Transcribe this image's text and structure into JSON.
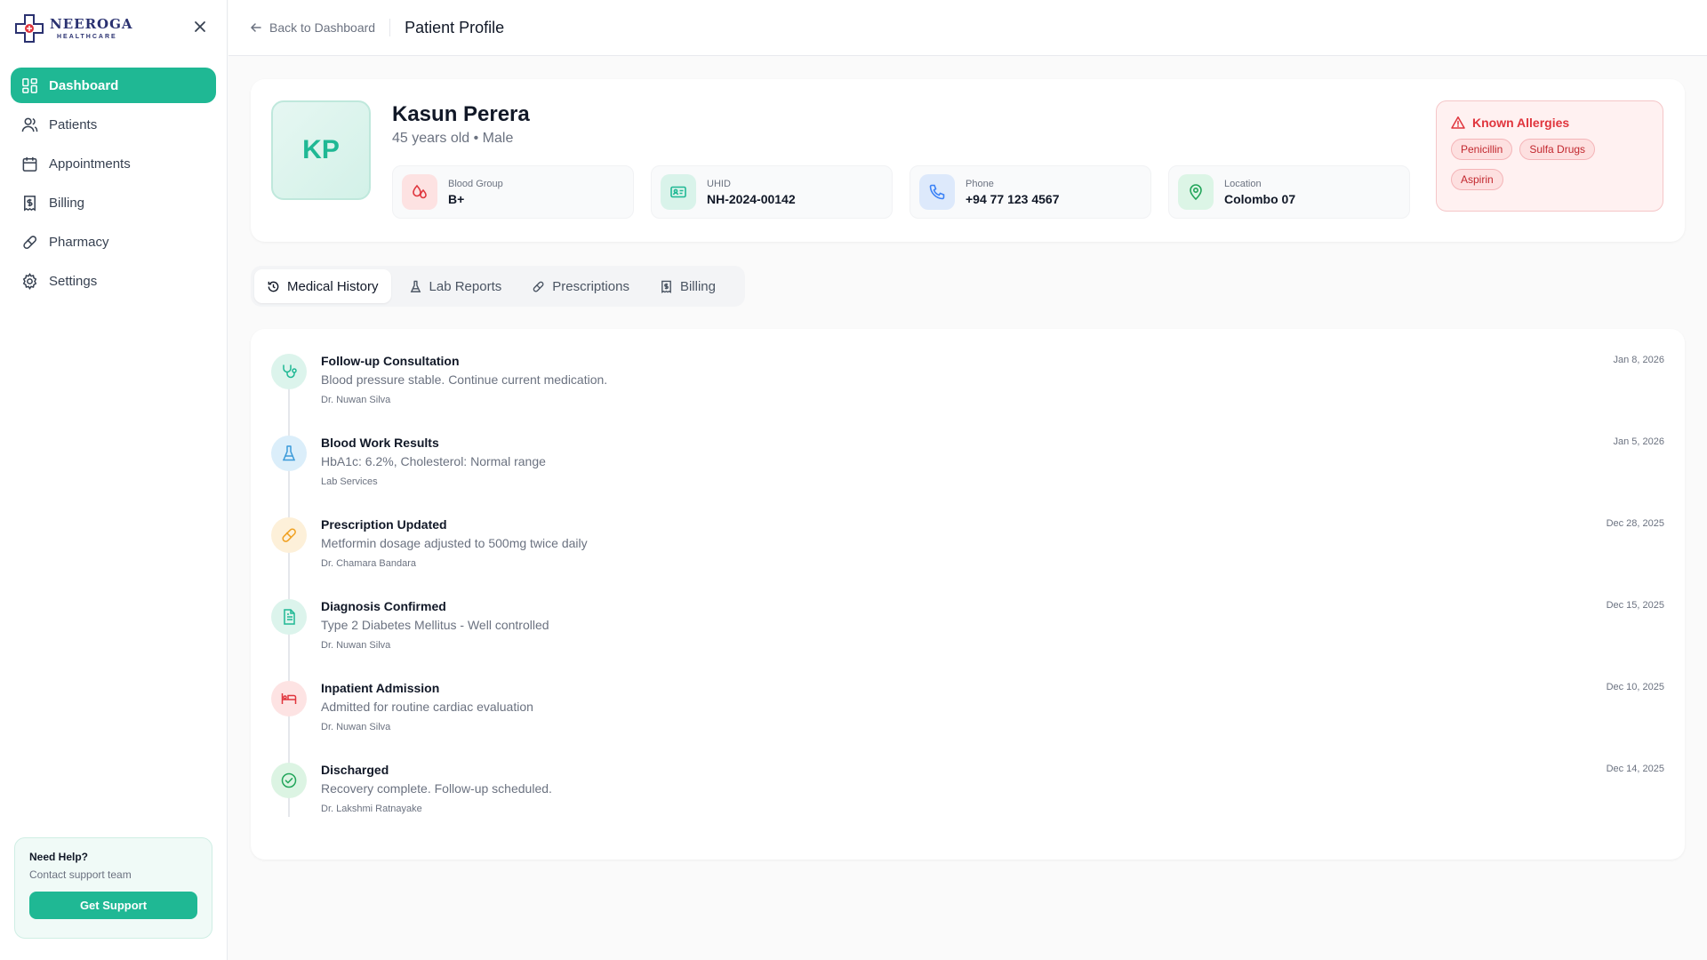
{
  "brand": {
    "name": "NEEROGA",
    "sub": "HEALTHCARE"
  },
  "sidebar": {
    "items": [
      {
        "label": "Dashboard",
        "icon": "grid-icon",
        "active": true
      },
      {
        "label": "Patients",
        "icon": "users-icon"
      },
      {
        "label": "Appointments",
        "icon": "calendar-icon"
      },
      {
        "label": "Billing",
        "icon": "receipt-icon"
      },
      {
        "label": "Pharmacy",
        "icon": "pill-icon"
      },
      {
        "label": "Settings",
        "icon": "gear-icon"
      }
    ],
    "help": {
      "title": "Need Help?",
      "subtitle": "Contact support team",
      "button": "Get Support"
    }
  },
  "header": {
    "back": "Back to Dashboard",
    "title": "Patient Profile"
  },
  "patient": {
    "initials": "KP",
    "name": "Kasun Perera",
    "meta": "45 years old • Male",
    "info": [
      {
        "label": "Blood Group",
        "value": "B+",
        "icon": "blood-drop-icon"
      },
      {
        "label": "UHID",
        "value": "NH-2024-00142",
        "icon": "id-card-icon"
      },
      {
        "label": "Phone",
        "value": "+94 77 123 4567",
        "icon": "phone-icon"
      },
      {
        "label": "Location",
        "value": "Colombo 07",
        "icon": "location-pin-icon"
      }
    ],
    "allergies": {
      "title": "Known Allergies",
      "items": [
        "Penicillin",
        "Sulfa Drugs",
        "Aspirin"
      ]
    }
  },
  "tabs": [
    {
      "label": "Medical History",
      "active": true
    },
    {
      "label": "Lab Reports"
    },
    {
      "label": "Prescriptions"
    },
    {
      "label": "Billing"
    }
  ],
  "history": [
    {
      "title": "Follow-up Consultation",
      "desc": "Blood pressure stable. Continue current medication.",
      "by": "Dr. Nuwan Silva",
      "date": "Jan 8, 2026",
      "icon": "stethoscope-icon"
    },
    {
      "title": "Blood Work Results",
      "desc": "HbA1c: 6.2%, Cholesterol: Normal range",
      "by": "Lab Services",
      "date": "Jan 5, 2026",
      "icon": "flask-icon"
    },
    {
      "title": "Prescription Updated",
      "desc": "Metformin dosage adjusted to 500mg twice daily",
      "by": "Dr. Chamara Bandara",
      "date": "Dec 28, 2025",
      "icon": "pill-icon"
    },
    {
      "title": "Diagnosis Confirmed",
      "desc": "Type 2 Diabetes Mellitus - Well controlled",
      "by": "Dr. Nuwan Silva",
      "date": "Dec 15, 2025",
      "icon": "document-icon"
    },
    {
      "title": "Inpatient Admission",
      "desc": "Admitted for routine cardiac evaluation",
      "by": "Dr. Nuwan Silva",
      "date": "Dec 10, 2025",
      "icon": "bed-icon"
    },
    {
      "title": "Discharged",
      "desc": "Recovery complete. Follow-up scheduled.",
      "by": "Dr. Lakshmi Ratnayake",
      "date": "Dec 14, 2025",
      "icon": "check-circle-icon"
    }
  ],
  "colors": {
    "accent": "#1fb894",
    "danger": "#e0353d",
    "brand": "#2a3170"
  }
}
